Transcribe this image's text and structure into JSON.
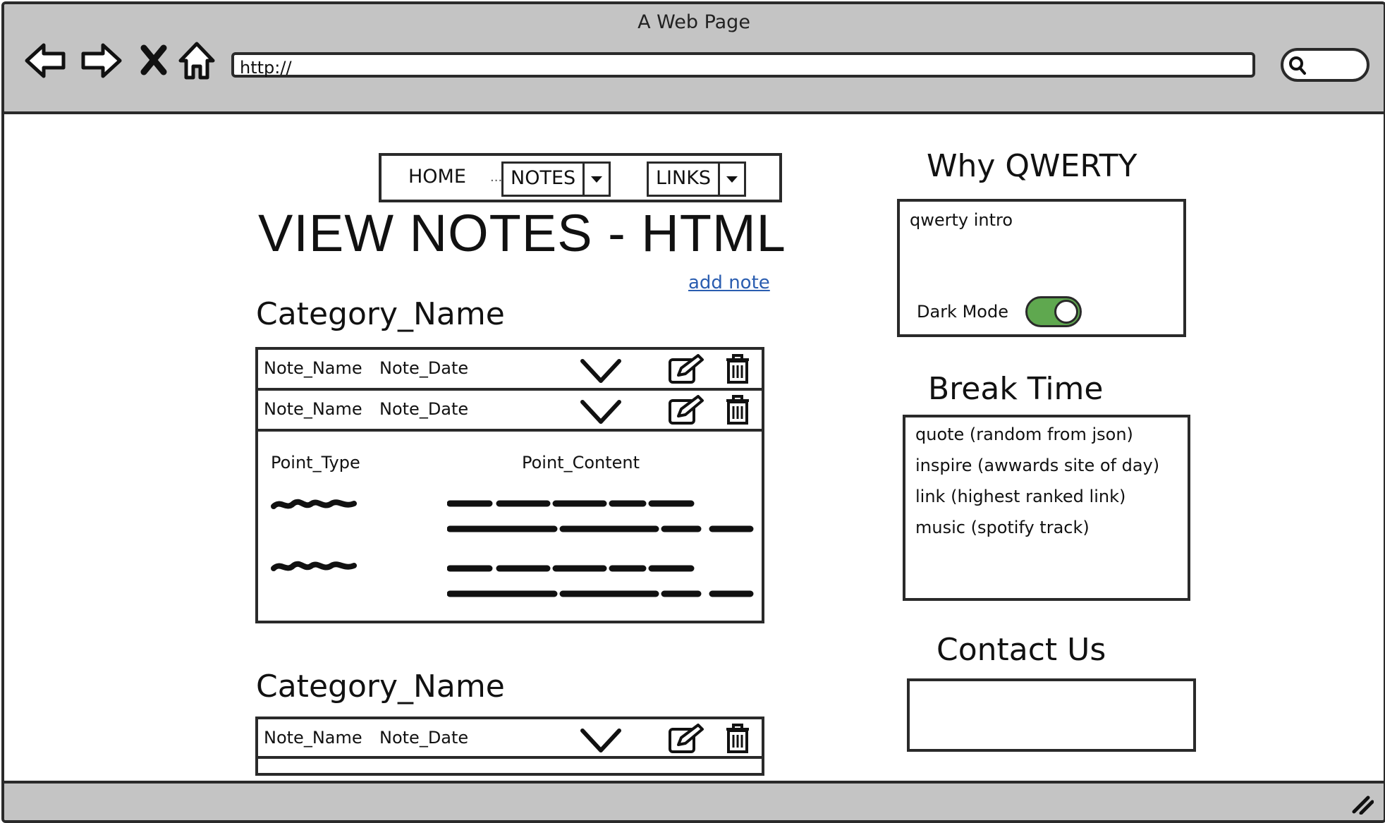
{
  "window": {
    "title": "A Web Page",
    "url": "http://"
  },
  "browser_icons": [
    "back-arrow-icon",
    "forward-arrow-icon",
    "close-icon",
    "home-icon",
    "search-icon",
    "resize-grip-icon"
  ],
  "menu": {
    "home": "HOME",
    "dots": "...",
    "notes": "NOTES",
    "links": "LINKS"
  },
  "page": {
    "title": "VIEW NOTES - HTML",
    "add_note": "add note"
  },
  "categories": [
    {
      "title": "Category_Name",
      "notes": [
        {
          "name": "Note_Name",
          "date": "Note_Date"
        },
        {
          "name": "Note_Name",
          "date": "Note_Date"
        }
      ],
      "detail": {
        "col1": "Point_Type",
        "col2": "Point_Content"
      }
    },
    {
      "title": "Category_Name",
      "notes": [
        {
          "name": "Note_Name",
          "date": "Note_Date"
        }
      ]
    }
  ],
  "sidebar": {
    "why": {
      "title": "Why QWERTY",
      "intro": "qwerty intro",
      "dark_mode_label": "Dark Mode",
      "dark_mode_on": true
    },
    "break": {
      "title": "Break Time",
      "items": [
        "quote (random from json)",
        "inspire (awwards site of day)",
        "link (highest ranked link)",
        "music (spotify track)"
      ]
    },
    "contact": {
      "title": "Contact Us"
    }
  },
  "colors": {
    "chrome": "#c4c4c4",
    "toggle_on": "#5fa84f",
    "link": "#2a5db0"
  }
}
